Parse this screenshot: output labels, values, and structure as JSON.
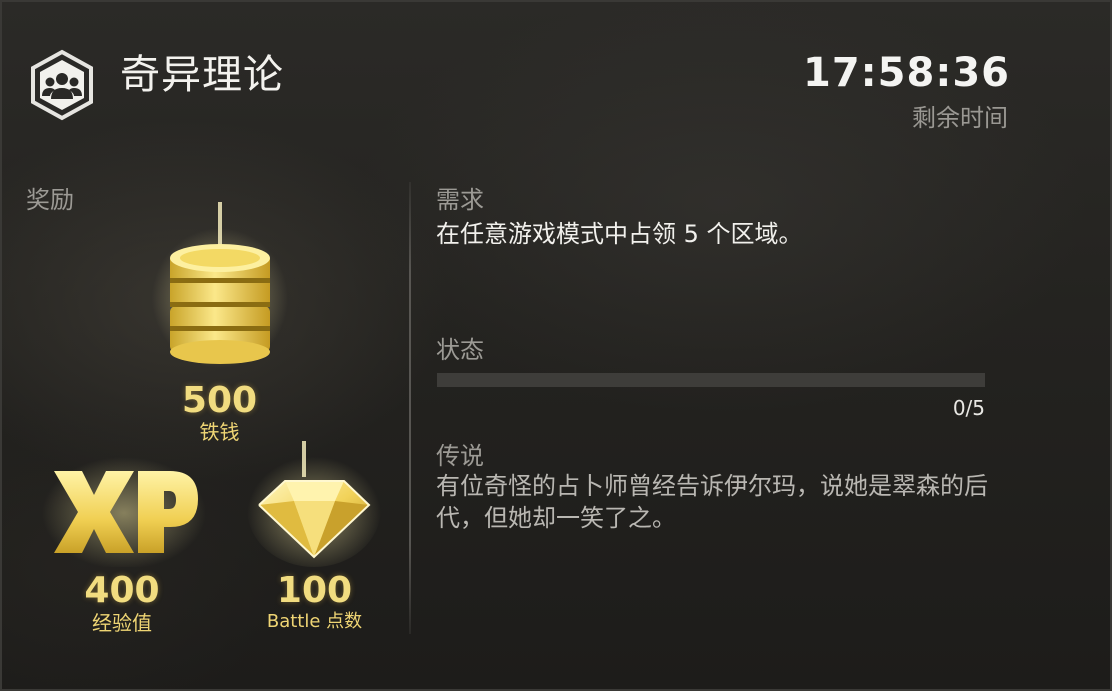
{
  "header": {
    "title": "奇异理论",
    "emblem_icon": "group-hexagon-icon",
    "timer": "17:58:36",
    "timer_label": "剩余时间"
  },
  "rewards": {
    "label": "奖励",
    "items": [
      {
        "icon": "coin-stack-icon",
        "value": "500",
        "label": "铁钱"
      },
      {
        "icon": "xp-icon",
        "value": "400",
        "label": "经验值"
      },
      {
        "icon": "diamond-icon",
        "value": "100",
        "label": "Battle 点数"
      }
    ]
  },
  "requirement": {
    "label": "需求",
    "text": "在任意游戏模式中占领 5 个区域。"
  },
  "status": {
    "label": "状态",
    "progress_text": "0/5",
    "progress_fraction": 0
  },
  "lore": {
    "label": "传说",
    "text": "有位奇怪的占卜师曾经告诉伊尔玛，说她是翠森的后代，但她却一笑了之。"
  },
  "colors": {
    "gold": "#f1dc80",
    "progress_track": "#3e3d3a"
  }
}
